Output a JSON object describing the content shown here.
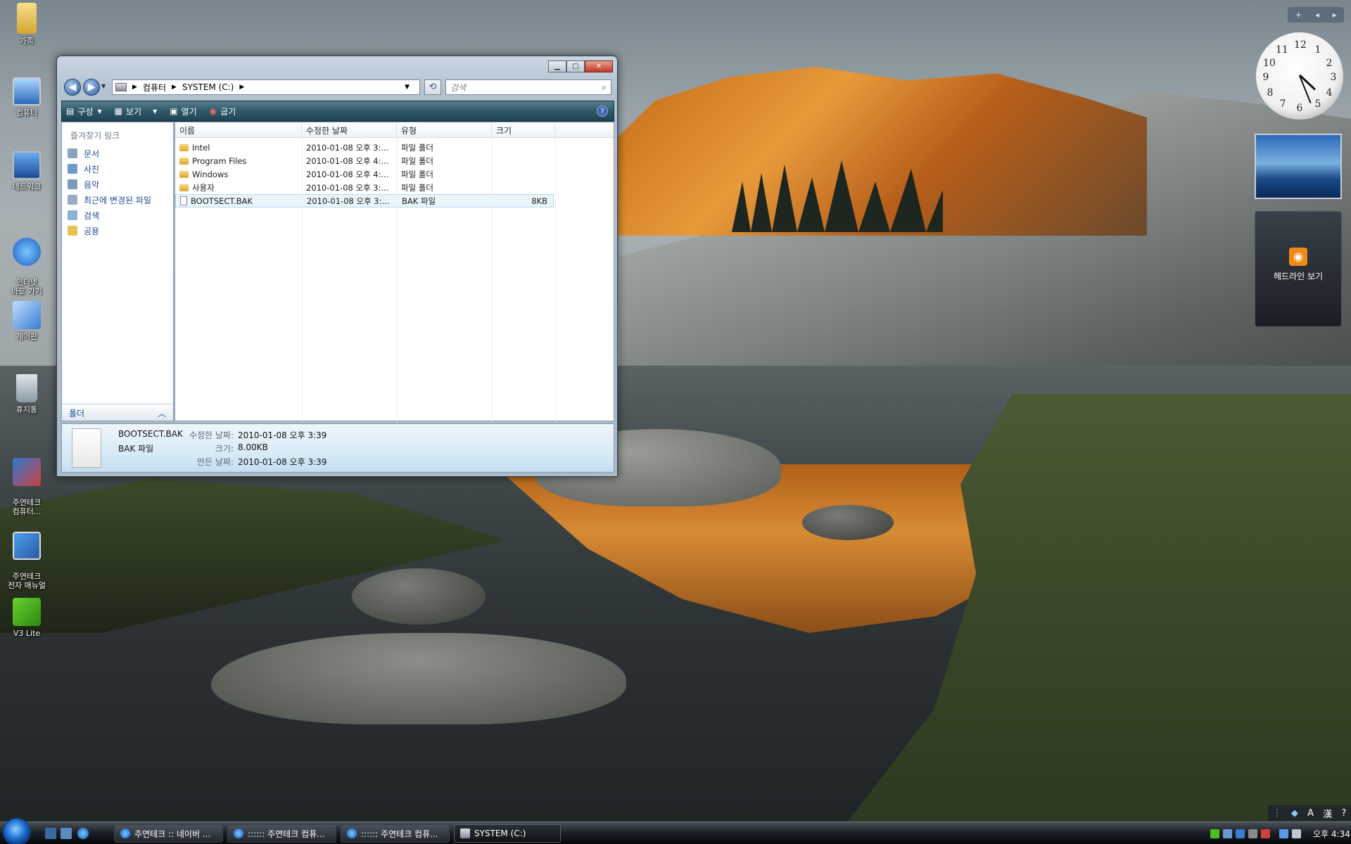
{
  "desktop_icons": [
    {
      "label": "가족",
      "icon": "folder-icon"
    },
    {
      "label": "컴퓨터",
      "icon": "computer-icon"
    },
    {
      "label": "네트워크",
      "icon": "network-icon"
    },
    {
      "label": "인터넷\n바로 가기",
      "icon": "internet-explorer-icon"
    },
    {
      "label": "제어판",
      "icon": "control-panel-icon"
    },
    {
      "label": "휴지통",
      "icon": "recycle-bin-icon"
    },
    {
      "label": "주연테크\n컴퓨터...",
      "icon": "help-icon"
    },
    {
      "label": "주연테크\n전자 매뉴얼",
      "icon": "manual-icon"
    },
    {
      "label": "V3 Lite",
      "icon": "v3-icon"
    }
  ],
  "explorer": {
    "address": {
      "seg1": "컴퓨터",
      "seg2": "SYSTEM (C:)"
    },
    "search_placeholder": "검색",
    "toolbar": {
      "organize": "구성",
      "views": "보기",
      "open": "열기",
      "burn": "굽기",
      "help": "?"
    },
    "nav": {
      "title": "즐겨찾기 링크",
      "items": [
        "문서",
        "사진",
        "음악",
        "최근에 변경된 파일",
        "검색",
        "공용"
      ],
      "folders_label": "폴더"
    },
    "columns": {
      "name": "이름",
      "date": "수정한 날짜",
      "type": "유형",
      "size": "크기"
    },
    "rows": [
      {
        "name": "Intel",
        "date": "2010-01-08 오후 3:...",
        "type": "파일 폴더",
        "size": "",
        "kind": "folder"
      },
      {
        "name": "Program Files",
        "date": "2010-01-08 오후 4:...",
        "type": "파일 폴더",
        "size": "",
        "kind": "folder"
      },
      {
        "name": "Windows",
        "date": "2010-01-08 오후 4:...",
        "type": "파일 폴더",
        "size": "",
        "kind": "folder"
      },
      {
        "name": "사용자",
        "date": "2010-01-08 오후 3:...",
        "type": "파일 폴더",
        "size": "",
        "kind": "folder"
      },
      {
        "name": "BOOTSECT.BAK",
        "date": "2010-01-08 오후 3:...",
        "type": "BAK 파일",
        "size": "8KB",
        "kind": "file"
      }
    ],
    "details": {
      "name": "BOOTSECT.BAK",
      "type": "BAK 파일",
      "modified_label": "수정한 날짜:",
      "modified": "2010-01-08 오후 3:39",
      "size_label": "크기:",
      "size": "8.00KB",
      "created_label": "만든 날짜:",
      "created": "2010-01-08 오후 3:39"
    }
  },
  "gadgets": {
    "bar_plus": "+",
    "clock_numbers": [
      "12",
      "1",
      "2",
      "3",
      "4",
      "5",
      "6",
      "7",
      "8",
      "9",
      "10",
      "11"
    ],
    "feed_label": "헤드라인 보기"
  },
  "langbar": {
    "mode": "A",
    "hanja": "漢",
    "help": "?"
  },
  "taskbar": {
    "tasks": [
      "주연테크 :: 네이버 ...",
      ":::::: 주연테크 컴퓨...",
      ":::::: 주연테크 컴퓨...",
      "SYSTEM (C:)"
    ],
    "clock": "오후 4:34"
  }
}
